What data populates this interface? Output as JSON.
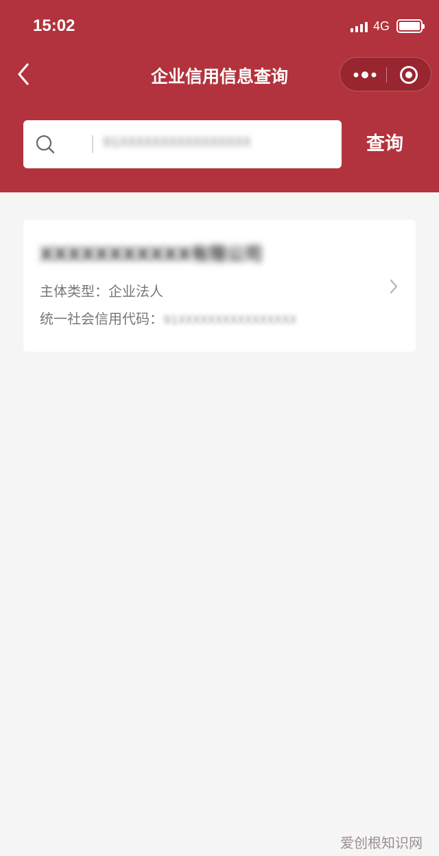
{
  "status_bar": {
    "time": "15:02",
    "network": "4G"
  },
  "nav": {
    "title": "企业信用信息查询",
    "more_icon": "more-dots-icon",
    "close_icon": "target-circle-icon"
  },
  "search": {
    "value": "91XXXXXXXXXXXXXXXX",
    "button_label": "查询"
  },
  "result": {
    "company_name": "XXXXXXXXXXX有限公司",
    "type_label": "主体类型：",
    "type_value": "企业法人",
    "code_label": "统一社会信用代码：",
    "code_value": "91XXXXXXXXXXXXXXXX"
  },
  "watermark": "爱创根知识网",
  "colors": {
    "header_bg": "#b2333d",
    "page_bg": "#f5f5f5"
  }
}
